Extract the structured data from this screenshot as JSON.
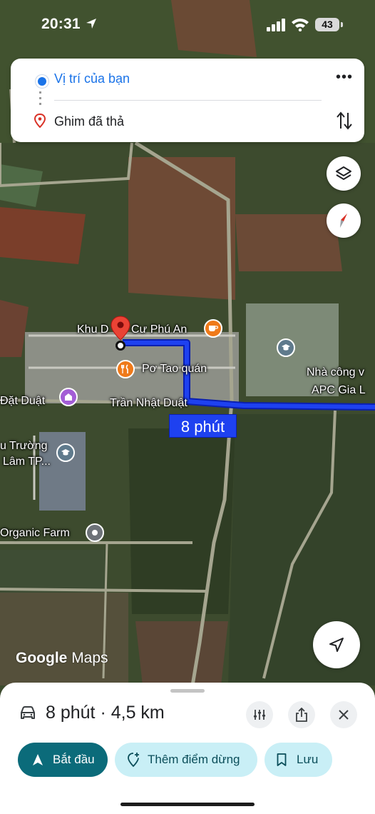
{
  "status_bar": {
    "time": "20:31",
    "battery": "43"
  },
  "directions": {
    "origin": "Vị trí của bạn",
    "destination": "Ghim đã thả"
  },
  "map": {
    "labels": {
      "khu_dan_cu": "Khu D",
      "khu_dan_cu_2": "Cư Phú An",
      "po_tao": "Pơ Tao quán",
      "tran_nhat_duat": "Trần Nhật Duật",
      "nhat_duat": "Đặt Duật",
      "nha_cong_1": "Nhà công v",
      "nha_cong_2": "APC Gia L",
      "truong_1": "u Trường",
      "truong_2": "Lâm TP...",
      "organic": "Organic Farm"
    },
    "route_time": "8 phút",
    "logo_google": "Google",
    "logo_maps": "Maps"
  },
  "sheet": {
    "summary": "8 phút · 4,5 km",
    "start_label": "Bắt đầu",
    "add_stop_label": "Thêm điểm dừng",
    "save_label": "Lưu"
  },
  "colors": {
    "route": "#1e41f0",
    "primary": "#0b6b7a",
    "secondary": "#c9eff6",
    "accent": "#1a73e8"
  },
  "icons": [
    "location-arrow-icon",
    "signal-icon",
    "wifi-icon",
    "battery-icon",
    "origin-dot-icon",
    "pin-icon",
    "more-icon",
    "swap-icon",
    "layers-icon",
    "compass-icon",
    "my-location-icon",
    "car-icon",
    "options-icon",
    "share-icon",
    "close-icon",
    "navigation-icon",
    "add-stop-icon",
    "bookmark-icon"
  ]
}
